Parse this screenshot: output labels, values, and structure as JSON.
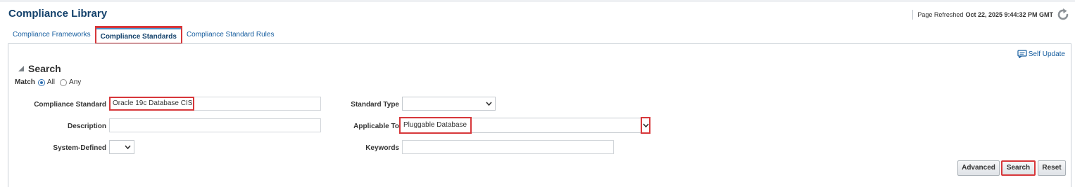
{
  "page": {
    "title": "Compliance Library"
  },
  "refresh": {
    "label": "Page Refreshed",
    "timestamp": "Oct 22, 2025 9:44:32 PM GMT"
  },
  "tabs": [
    {
      "label": "Compliance Frameworks",
      "active": false
    },
    {
      "label": "Compliance Standards",
      "active": true
    },
    {
      "label": "Compliance Standard Rules",
      "active": false
    }
  ],
  "self_update": {
    "label": "Self Update",
    "icon": "chat-bubble-icon"
  },
  "search": {
    "title": "Search",
    "match": {
      "label": "Match",
      "options": [
        "All",
        "Any"
      ],
      "selected": "All"
    },
    "fields": {
      "compliance_standard": {
        "label": "Compliance Standard",
        "value": "Oracle 19c Database CIS"
      },
      "description": {
        "label": "Description",
        "value": ""
      },
      "system_defined": {
        "label": "System-Defined",
        "value": ""
      },
      "standard_type": {
        "label": "Standard Type",
        "value": ""
      },
      "applicable_to": {
        "label": "Applicable To",
        "value": "Pluggable Database"
      },
      "keywords": {
        "label": "Keywords",
        "value": ""
      }
    },
    "buttons": {
      "advanced": "Advanced",
      "search": "Search",
      "reset": "Reset"
    }
  },
  "colors": {
    "title": "#13416b",
    "link": "#145c9e",
    "highlight": "#d7373a",
    "radio": "#2f6fb1"
  }
}
